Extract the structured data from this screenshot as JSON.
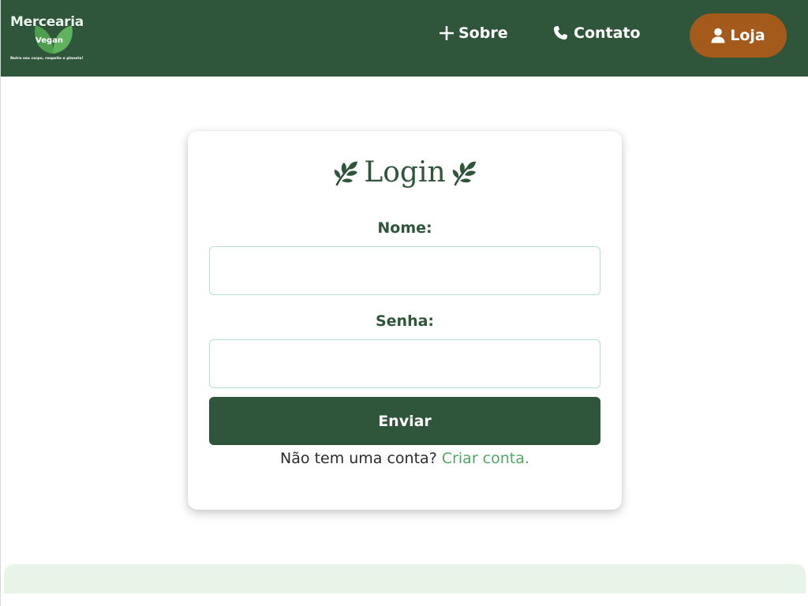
{
  "header": {
    "logo": {
      "title": "Mercearia",
      "subtitle": "Vegan",
      "tagline": "Nutra seu corpo, respeite o planeta!"
    },
    "nav": {
      "sobre": "Sobre",
      "contato": "Contato",
      "loja": "Loja"
    }
  },
  "login": {
    "title": "Login",
    "nome_label": "Nome:",
    "nome_value": "",
    "senha_label": "Senha:",
    "senha_value": "",
    "submit_label": "Enviar",
    "signup_prompt": "Não tem uma conta?",
    "signup_link": "Criar conta."
  },
  "icons": {
    "sobre": "plus-icon",
    "contato": "phone-icon",
    "loja": "user-icon",
    "title_left": "leaf-icon",
    "title_right": "leaf-icon"
  },
  "colors": {
    "brand_green": "#2f553b",
    "accent_brown": "#a45a1a",
    "link_green": "#4ea863",
    "footer_bg": "#e8f4e7",
    "input_border": "#b9dfcf"
  }
}
